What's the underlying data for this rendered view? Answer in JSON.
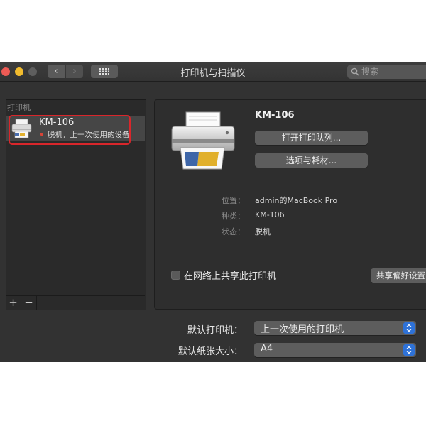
{
  "window": {
    "title": "打印机与扫描仪"
  },
  "toolbar": {
    "back_label": "‹",
    "forward_label": "›",
    "search_placeholder": "搜索"
  },
  "sidebar": {
    "heading": "打印机",
    "printers": [
      {
        "name": "KM-106",
        "status": "脱机，上一次使用的设备",
        "status_color": "#d84437"
      }
    ],
    "add_label": "+",
    "remove_label": "−"
  },
  "detail": {
    "name": "KM-106",
    "open_queue_label": "打开打印队列...",
    "options_label": "选项与耗材...",
    "info": [
      {
        "label": "位置：",
        "value": "admin的MacBook Pro"
      },
      {
        "label": "种类：",
        "value": "KM-106"
      },
      {
        "label": "状态：",
        "value": "脱机"
      }
    ],
    "share_label": "在网络上共享此打印机",
    "share_checked": false,
    "share_prefs_label": "共享偏好设置..."
  },
  "defaults": {
    "printer_label": "默认打印机：",
    "printer_value": "上一次使用的打印机",
    "paper_label": "默认纸张大小：",
    "paper_value": "A4"
  },
  "colors": {
    "highlight": "#d9262b",
    "accent": "#2e72d8",
    "window_bg": "#323232"
  }
}
